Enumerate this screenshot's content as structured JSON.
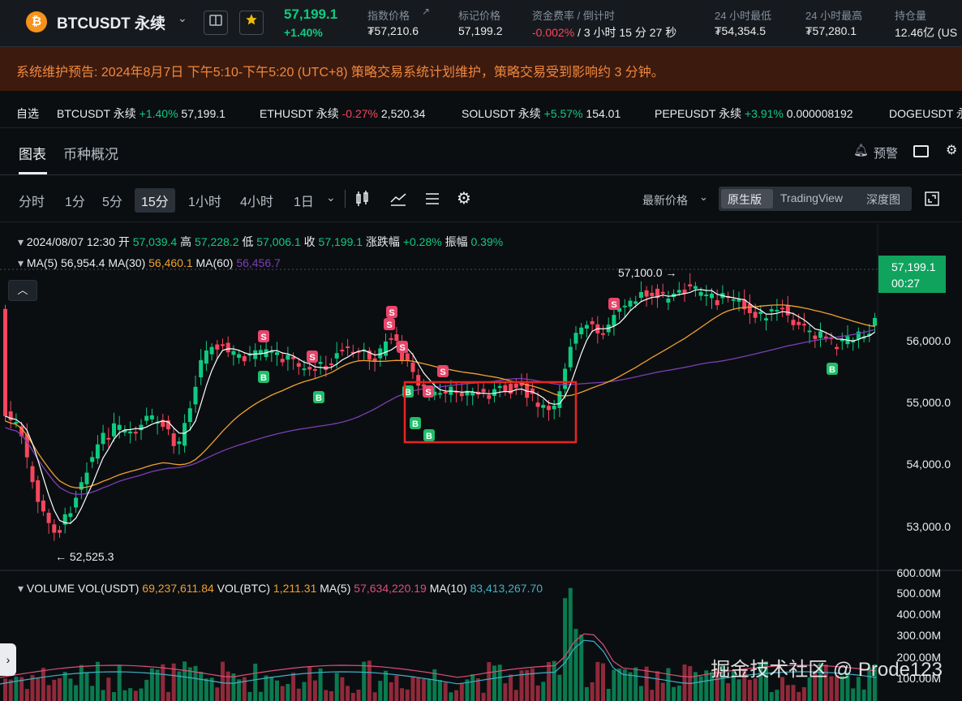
{
  "header": {
    "symbol": "BTCUSDT 永续",
    "last_price": "57,199.1",
    "change_pct": "+1.40%",
    "stats": [
      {
        "label": "指数价格",
        "value": "₮57,210.6"
      },
      {
        "label": "标记价格",
        "value": "57,199.2"
      },
      {
        "label": "资金费率 / 倒计时",
        "value_neg": "-0.002%",
        "value_rest": " / 3 小时 15 分 27 秒"
      },
      {
        "label": "24 小时最低",
        "value": "₮54,354.5"
      },
      {
        "label": "24 小时最高",
        "value": "₮57,280.1"
      },
      {
        "label": "持仓量",
        "value": "12.46亿 (US"
      }
    ]
  },
  "notice": "系统维护预告: 2024年8月7日 下午5:10-下午5:20 (UTC+8) 策略交易系统计划维护，策略交易受到影响约 3 分钟。",
  "ticker": {
    "label": "自选",
    "items": [
      {
        "name": "BTCUSDT 永续",
        "change": "+1.40%",
        "price": "57,199.1",
        "dir": "up"
      },
      {
        "name": "ETHUSDT 永续",
        "change": "-0.27%",
        "price": "2,520.34",
        "dir": "dn"
      },
      {
        "name": "SOLUSDT 永续",
        "change": "+5.57%",
        "price": "154.01",
        "dir": "up"
      },
      {
        "name": "PEPEUSDT 永续",
        "change": "+3.91%",
        "price": "0.000008192",
        "dir": "up"
      },
      {
        "name": "DOGEUSDT 永",
        "change": "",
        "price": "",
        "dir": "up"
      }
    ]
  },
  "tabs": {
    "chart": "图表",
    "info": "币种概况",
    "alert": "预警"
  },
  "toolbar": {
    "timeframes": [
      "分时",
      "1分",
      "5分",
      "15分",
      "1小时",
      "4小时",
      "1日"
    ],
    "active": "15分",
    "price_type": "最新价格",
    "views": [
      "原生版",
      "TradingView",
      "深度图"
    ]
  },
  "ohlc": {
    "date": "2024/08/07 12:30",
    "open_label": "开",
    "open": "57,039.4",
    "high_label": "高",
    "high": "57,228.2",
    "low_label": "低",
    "low": "57,006.1",
    "close_label": "收",
    "close": "57,199.1",
    "chg_label": "涨跌幅",
    "chg": "+0.28%",
    "amp_label": "振幅",
    "amp": "0.39%"
  },
  "ma": {
    "ma5_label": "MA(5)",
    "ma5": "56,954.4",
    "ma30_label": "MA(30)",
    "ma30": "56,460.1",
    "ma60_label": "MA(60)",
    "ma60": "56,456.7"
  },
  "price_axis": [
    "56,000.0",
    "55,000.0",
    "54,000.0",
    "53,000.0"
  ],
  "last_tag": {
    "price": "57,199.1",
    "countdown": "00:27"
  },
  "annotations": {
    "high": "57,100.0 →",
    "low": "← 52,525.3"
  },
  "volume": {
    "title": "VOLUME",
    "vol_usdt_label": "VOL(USDT)",
    "vol_usdt": "69,237,611.84",
    "vol_btc_label": "VOL(BTC)",
    "vol_btc": "1,211.31",
    "ma5_label": "MA(5)",
    "ma5": "57,634,220.19",
    "ma10_label": "MA(10)",
    "ma10": "83,413,267.70",
    "axis": [
      "600.00M",
      "500.00M",
      "400.00M",
      "300.00M",
      "200.00M",
      "100.00M"
    ]
  },
  "watermark": "掘金技术社区 @ Prode123",
  "colors": {
    "up": "#0ecb81",
    "down": "#f6465d",
    "ma5": "#ffffff",
    "ma30": "#f0a030",
    "ma60": "#7b3fb5",
    "highlight": "#e8251f"
  }
}
